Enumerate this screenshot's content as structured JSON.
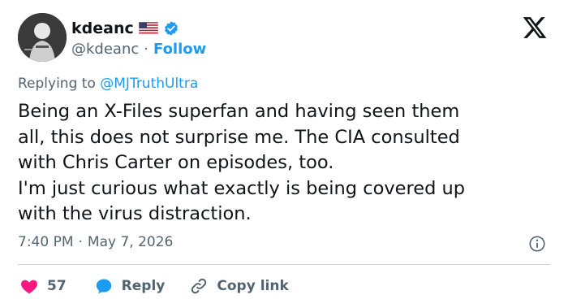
{
  "author": {
    "display_name": "kdeanc",
    "flag_emoji": "us-flag-icon",
    "verified": true,
    "handle": "@kdeanc",
    "separator": "·",
    "follow_label": "Follow"
  },
  "reply_context": {
    "prefix": "Replying to",
    "handle": "@MJTruthUltra"
  },
  "tweet": {
    "lines": [
      "Being an X-Files superfan and having seen them",
      "all, this does not surprise me. The CIA consulted",
      "with Chris Carter on episodes, too.",
      "I'm just curious what exactly is being covered up",
      "with the virus distraction."
    ]
  },
  "meta": {
    "time": "7:40 PM",
    "separator": "·",
    "date": "May 7, 2026"
  },
  "actions": {
    "like_count": "57",
    "reply_label": "Reply",
    "copy_link_label": "Copy link"
  },
  "colors": {
    "accent": "#1d9bf0",
    "like": "#f91880",
    "muted": "#536471",
    "text": "#0f1419",
    "divider": "#cfd9de"
  }
}
